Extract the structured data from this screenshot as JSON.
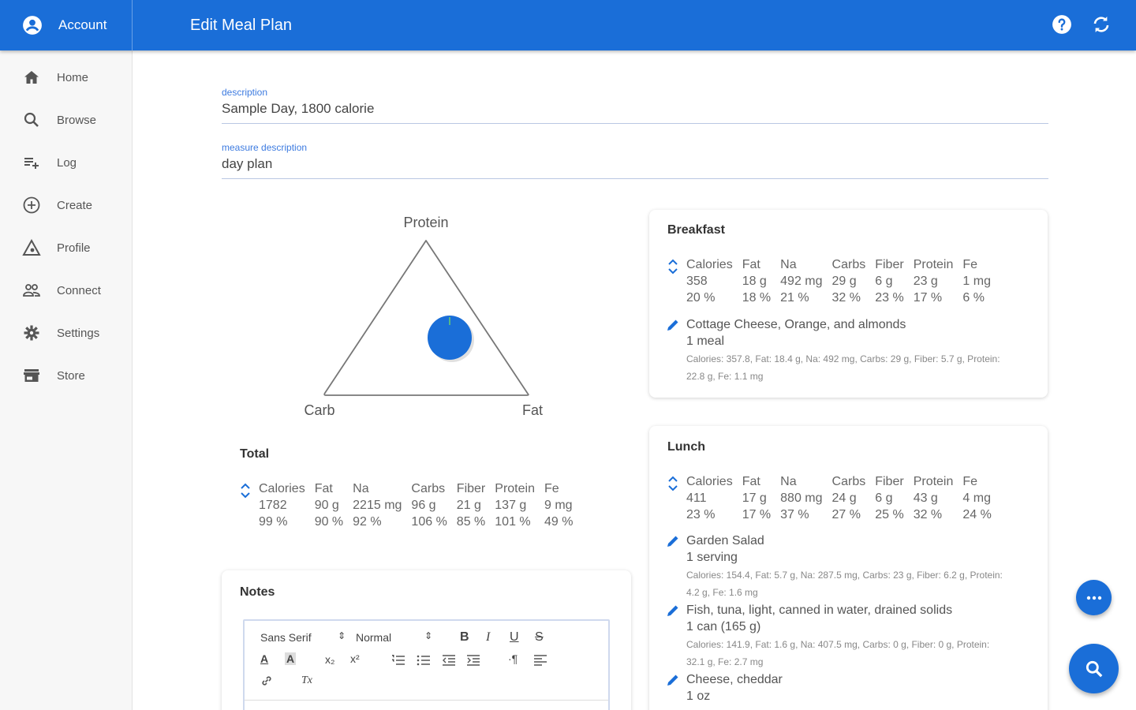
{
  "topbar": {
    "account_label": "Account",
    "title": "Edit Meal Plan",
    "help_icon": "help-icon",
    "sync_icon": "sync-icon"
  },
  "sidebar": {
    "items": [
      {
        "label": "Home",
        "icon": "home-icon"
      },
      {
        "label": "Browse",
        "icon": "search-icon"
      },
      {
        "label": "Log",
        "icon": "playlist-add-icon"
      },
      {
        "label": "Create",
        "icon": "add-circle-icon"
      },
      {
        "label": "Profile",
        "icon": "triangle-icon"
      },
      {
        "label": "Connect",
        "icon": "people-icon"
      },
      {
        "label": "Settings",
        "icon": "gear-icon"
      },
      {
        "label": "Store",
        "icon": "store-icon"
      }
    ]
  },
  "form": {
    "description_label": "description",
    "description_value": "Sample Day, 1800 calorie",
    "measure_label": "measure description",
    "measure_value": "day plan"
  },
  "chart": {
    "top_label": "Protein",
    "left_label": "Carb",
    "right_label": "Fat",
    "point_color": "#1a6ed8"
  },
  "total": {
    "title": "Total",
    "headers": [
      "Calories",
      "Fat",
      "Na",
      "Carbs",
      "Fiber",
      "Protein",
      "Fe"
    ],
    "amounts": [
      "1782",
      "90 g",
      "2215 mg",
      "96 g",
      "21 g",
      "137 g",
      "9 mg"
    ],
    "percents": [
      "99 %",
      "90 %",
      "92 %",
      "106 %",
      "85 %",
      "101 %",
      "49 %"
    ]
  },
  "breakfast": {
    "title": "Breakfast",
    "headers": [
      "Calories",
      "Fat",
      "Na",
      "Carbs",
      "Fiber",
      "Protein",
      "Fe"
    ],
    "amounts": [
      "358",
      "18 g",
      "492 mg",
      "29 g",
      "6 g",
      "23 g",
      "1 mg"
    ],
    "percents": [
      "20 %",
      "18 %",
      "21 %",
      "32 %",
      "23 %",
      "17 %",
      "6 %"
    ],
    "foods": [
      {
        "name": "Cottage Cheese, Orange, and almonds",
        "amount": "1 meal",
        "detail": "Calories: 357.8, Fat: 18.4 g, Na: 492 mg, Carbs: 29 g, Fiber: 5.7 g, Protein: 22.8 g, Fe: 1.1 mg"
      }
    ]
  },
  "lunch": {
    "title": "Lunch",
    "headers": [
      "Calories",
      "Fat",
      "Na",
      "Carbs",
      "Fiber",
      "Protein",
      "Fe"
    ],
    "amounts": [
      "411",
      "17 g",
      "880 mg",
      "24 g",
      "6 g",
      "43 g",
      "4 mg"
    ],
    "percents": [
      "23 %",
      "17 %",
      "37 %",
      "27 %",
      "25 %",
      "32 %",
      "24 %"
    ],
    "foods": [
      {
        "name": "Garden Salad",
        "amount": "1 serving",
        "detail": "Calories: 154.4, Fat: 5.7 g, Na: 287.5 mg, Carbs: 23 g, Fiber: 6.2 g, Protein: 4.2 g, Fe: 1.6 mg"
      },
      {
        "name": "Fish, tuna, light, canned in water, drained solids",
        "amount": "1 can (165 g)",
        "detail": "Calories: 141.9, Fat: 1.6 g, Na: 407.5 mg, Carbs: 0 g, Fiber: 0 g, Protein: 32.1 g, Fe: 2.7 mg"
      },
      {
        "name": "Cheese, cheddar",
        "amount": "1 oz",
        "detail": ""
      }
    ]
  },
  "notes": {
    "title": "Notes",
    "font_select": "Sans Serif",
    "size_select": "Normal",
    "bold": "B",
    "italic": "I",
    "underline": "U",
    "strike": "S",
    "subscript": "x₂",
    "superscript": "x²",
    "clear_format": "Tx"
  },
  "fab": {
    "more_icon": "more-horiz-icon",
    "search_icon": "search-icon"
  }
}
